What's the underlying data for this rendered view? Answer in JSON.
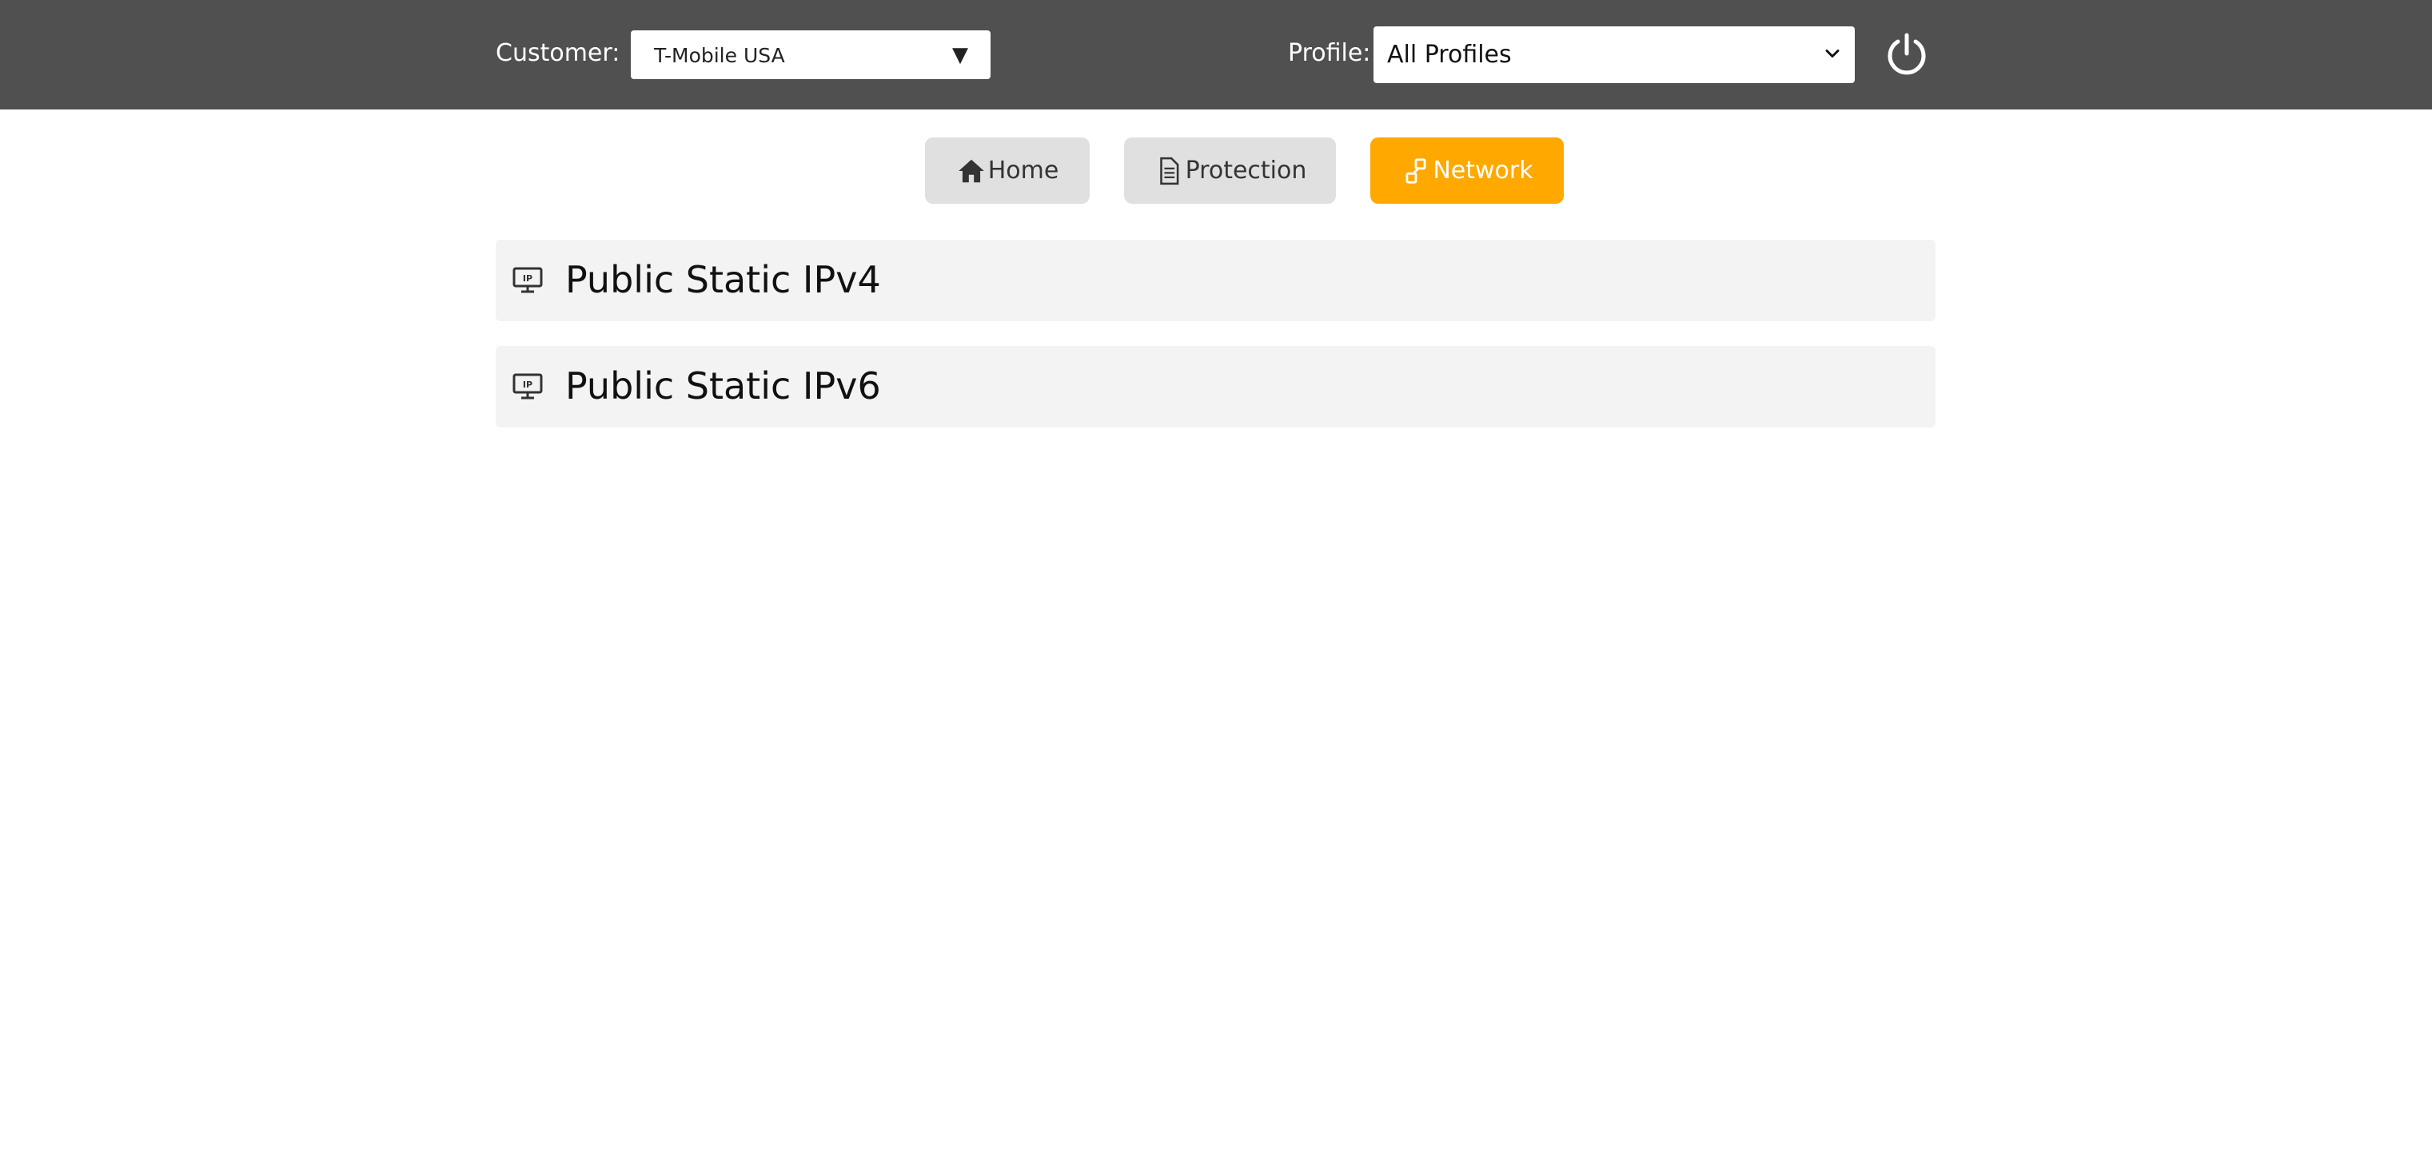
{
  "header": {
    "customer_label": "Customer:",
    "customer_value": "T-Mobile USA",
    "customer_arrow": "▼",
    "profile_label": "Profile:",
    "profile_value": "All Profiles",
    "power_icon": "power-icon"
  },
  "nav": {
    "tabs": [
      {
        "label": "Home",
        "icon": "home-icon",
        "active": false
      },
      {
        "label": "Protection",
        "icon": "document-icon",
        "active": false
      },
      {
        "label": "Network",
        "icon": "network-icon",
        "active": true
      }
    ]
  },
  "sections": [
    {
      "title": "Public Static IPv4",
      "icon": "ip-monitor-icon"
    },
    {
      "title": "Public Static IPv6",
      "icon": "ip-monitor-icon"
    }
  ],
  "colors": {
    "topbar": "#505050",
    "accent": "#ffa800",
    "tab_inactive": "#e0e0e0",
    "panel_bg": "#f3f3f3"
  }
}
